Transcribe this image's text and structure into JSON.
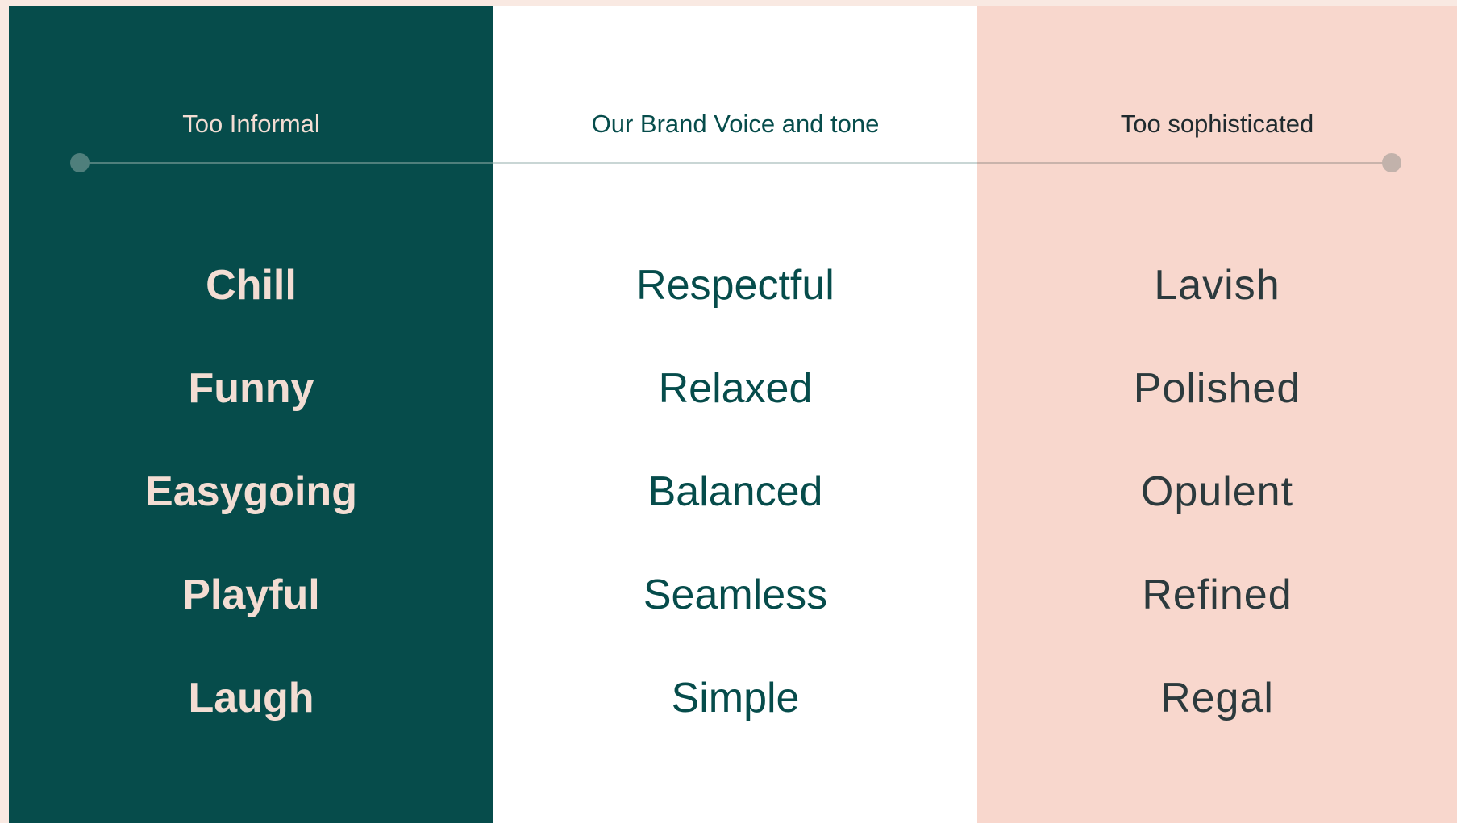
{
  "columns": {
    "left": {
      "header": "Too Informal",
      "words": [
        "Chill",
        "Funny",
        "Easygoing",
        "Playful",
        "Laugh"
      ]
    },
    "middle": {
      "header": "Our Brand Voice and tone",
      "words": [
        "Respectful",
        "Relaxed",
        "Balanced",
        "Seamless",
        "Simple"
      ]
    },
    "right": {
      "header": "Too sophisticated",
      "words": [
        "Lavish",
        "Polished",
        "Opulent",
        "Refined",
        "Regal"
      ]
    }
  },
  "colors": {
    "dark_teal": "#064c4b",
    "white": "#ffffff",
    "blush": "#f8d7cd",
    "cream_text": "#f3ddd3",
    "page_background": "#f9e9e2"
  }
}
